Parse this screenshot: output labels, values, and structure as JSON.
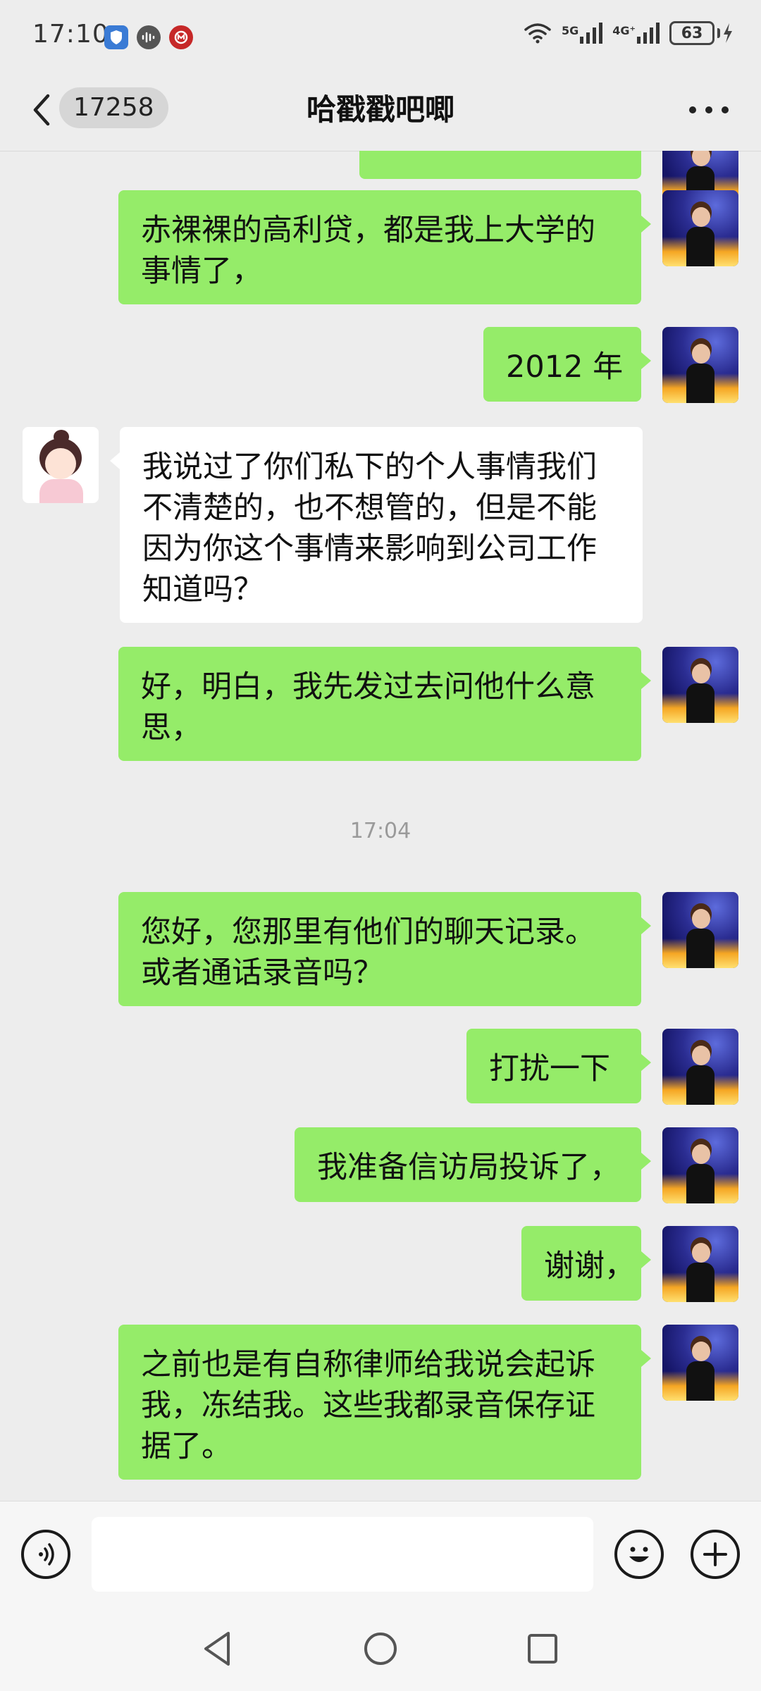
{
  "status_bar": {
    "time": "17:10",
    "net1": "5G",
    "net2": "4G⁺",
    "battery": "63"
  },
  "header": {
    "unread_count": "17258",
    "title": "哈戳戳吧唧"
  },
  "messages": [
    {
      "sender": "me",
      "text": ""
    },
    {
      "sender": "me",
      "text": "赤裸裸的高利贷，都是我上大学的事情了，"
    },
    {
      "sender": "me",
      "text": "2012 年"
    },
    {
      "sender": "them",
      "text": "我说过了你们私下的个人事情我们不清楚的，也不想管的，但是不能因为你这个事情来影响到公司工作知道吗？"
    },
    {
      "sender": "me",
      "text": "好，明白，我先发过去问他什么意思，"
    },
    {
      "sender": "me",
      "text": "您好，您那里有他们的聊天记录。或者通话录音吗？"
    },
    {
      "sender": "me",
      "text": "打扰一下"
    },
    {
      "sender": "me",
      "text": "我准备信访局投诉了，"
    },
    {
      "sender": "me",
      "text": "谢谢，"
    },
    {
      "sender": "me",
      "text": "之前也是有自称律师给我说会起诉我，冻结我。这些我都录音保存证据了。"
    }
  ],
  "timestamp": "17:04",
  "input": {
    "value": ""
  },
  "icons": {
    "back": "chevron-left-icon",
    "more": "more-horizontal-icon",
    "voice": "voice-input-icon",
    "emoji": "emoji-icon",
    "plus": "plus-icon"
  }
}
